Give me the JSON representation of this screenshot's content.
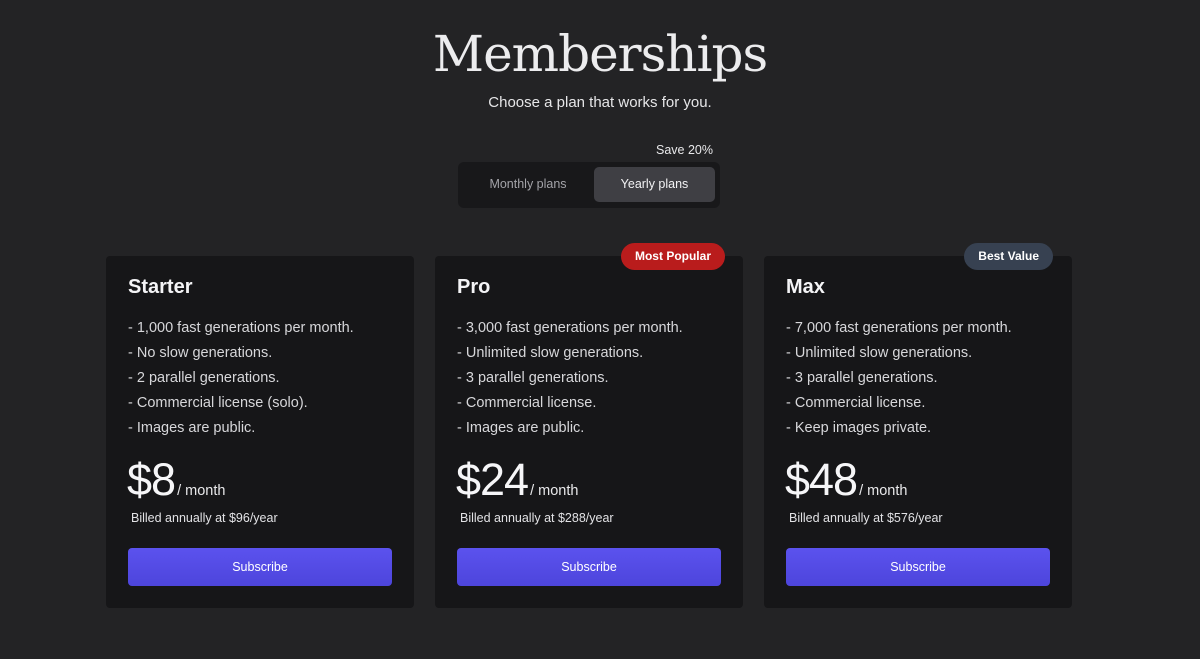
{
  "header": {
    "title": "Memberships",
    "subtitle": "Choose a plan that works for you."
  },
  "billing_toggle": {
    "save_note": "Save 20%",
    "options": [
      {
        "label": "Monthly plans",
        "selected": false
      },
      {
        "label": "Yearly plans",
        "selected": true
      }
    ]
  },
  "plans": [
    {
      "name": "Starter",
      "badge": "",
      "features": [
        "- 1,000 fast generations per month.",
        "- No slow generations.",
        "- 2 parallel generations.",
        "- Commercial license (solo).",
        "- Images are public."
      ],
      "price": "$8",
      "period": "/ month",
      "billed": "Billed annually at $96/year",
      "cta": "Subscribe"
    },
    {
      "name": "Pro",
      "badge": "Most Popular",
      "badge_color": "#b91c1c",
      "features": [
        "- 3,000 fast generations per month.",
        "- Unlimited slow generations.",
        "- 3 parallel generations.",
        "- Commercial license.",
        "- Images are public."
      ],
      "price": "$24",
      "period": "/ month",
      "billed": "Billed annually at $288/year",
      "cta": "Subscribe"
    },
    {
      "name": "Max",
      "badge": "Best Value",
      "badge_color": "#374151",
      "features": [
        "- 7,000 fast generations per month.",
        "- Unlimited slow generations.",
        "- 3 parallel generations.",
        "- Commercial license.",
        "- Keep images private."
      ],
      "price": "$48",
      "period": "/ month",
      "billed": "Billed annually at $576/year",
      "cta": "Subscribe"
    }
  ],
  "colors": {
    "background": "#232325",
    "card": "#161618",
    "accent": "#5b52ee",
    "toggle_selected": "#3f3f44"
  }
}
